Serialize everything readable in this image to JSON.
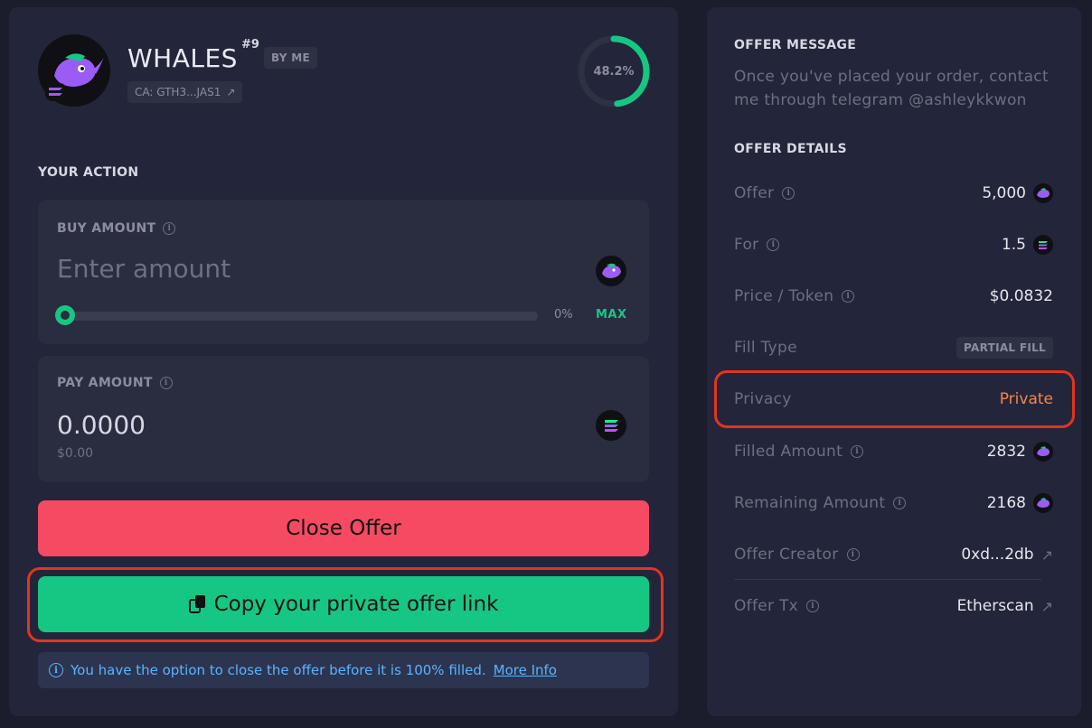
{
  "token": {
    "name": "WHALES",
    "rank": "#9",
    "by_me_badge": "BY ME",
    "contract": "CA: GTH3...JAS1",
    "fill_percent_label": "48.2%",
    "fill_percent": 48.2
  },
  "action": {
    "section_title": "YOUR ACTION",
    "buy": {
      "label": "BUY AMOUNT",
      "placeholder": "Enter amount",
      "slider_percent": "0%",
      "max_label": "MAX"
    },
    "pay": {
      "label": "PAY AMOUNT",
      "value": "0.0000",
      "usd_value": "$0.00"
    },
    "close_button": "Close Offer",
    "copy_button": "Copy your private offer link",
    "notice_text": "You have the option to close the offer before it is 100% filled.",
    "notice_link": "More Info"
  },
  "offer": {
    "message_title": "OFFER MESSAGE",
    "message": "Once you've placed your order, contact me through telegram @ashleykkwon",
    "details_title": "OFFER DETAILS",
    "rows": [
      {
        "label": "Offer",
        "value": "5,000"
      },
      {
        "label": "For",
        "value": "1.5"
      },
      {
        "label": "Price / Token",
        "value": "$0.0832"
      },
      {
        "label": "Fill Type",
        "value": "PARTIAL FILL"
      },
      {
        "label": "Privacy",
        "value": "Private"
      },
      {
        "label": "Filled Amount",
        "value": "2832"
      },
      {
        "label": "Remaining Amount",
        "value": "2168"
      },
      {
        "label": "Offer Creator",
        "value": "0xd...2db"
      },
      {
        "label": "Offer Tx",
        "value": "Etherscan"
      }
    ]
  },
  "colors": {
    "accent_green": "#16c784",
    "close_red": "#f54a62",
    "private_orange": "#f4864a",
    "highlight_red": "#e2351e",
    "info_blue": "#5ab4ff"
  }
}
